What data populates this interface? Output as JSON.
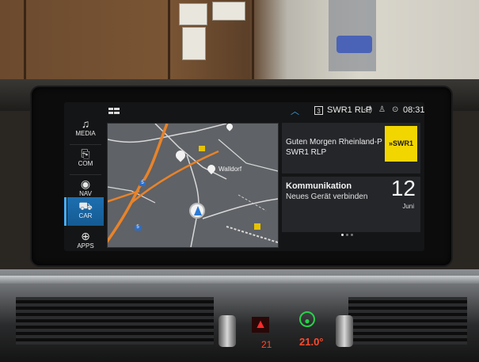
{
  "statusbar": {
    "split_icon": "split-screen-icon",
    "up_icon": "chevron-up-icon",
    "preset_number": "3",
    "station": "SWR1 RLP",
    "volume_icon": "speaker-icon",
    "profile_icon": "person-icon",
    "connectivity_icon": "connection-icon",
    "time": "08:31"
  },
  "sidebar": {
    "items": [
      {
        "label": "MEDIA",
        "icon": "music-note-icon",
        "glyph": "♫"
      },
      {
        "label": "COM",
        "icon": "phone-icon",
        "glyph": "⎘"
      },
      {
        "label": "NAV",
        "icon": "compass-icon",
        "glyph": "◉"
      },
      {
        "label": "CAR",
        "icon": "car-icon",
        "glyph": "⛟"
      },
      {
        "label": "APPS",
        "icon": "globe-icon",
        "glyph": "⊕"
      }
    ],
    "active": "CAR"
  },
  "map": {
    "town": "Walldorf",
    "road_label_a": "5",
    "road_label_b": "5"
  },
  "radio_widget": {
    "line1": "Guten Morgen Rheinland-P",
    "line2": "SWR1 RLP",
    "logo_text": "»SWR1"
  },
  "comm_widget": {
    "title": "Kommunikation",
    "subtitle": "Neues Gerät verbinden",
    "day": "12",
    "month": "Juni"
  },
  "console": {
    "temp_left": "21",
    "temp_right": "21.0°"
  },
  "colors": {
    "accent": "#1d6fb0",
    "highlight": "#3aa6e8",
    "radio_logo": "#f2d600",
    "route": "#e8832a"
  }
}
